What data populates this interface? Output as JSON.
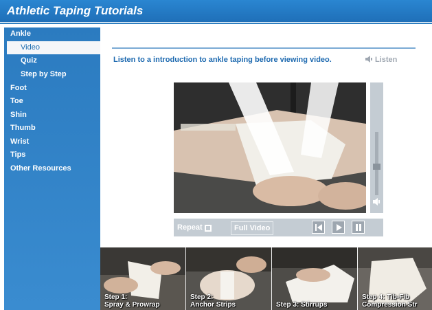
{
  "app": {
    "title": "Athletic Taping Tutorials"
  },
  "sidebar": {
    "items": [
      {
        "label": "Ankle",
        "level": "top"
      },
      {
        "label": "Video",
        "level": "sub",
        "active": true
      },
      {
        "label": "Quiz",
        "level": "sub"
      },
      {
        "label": "Step by Step",
        "level": "sub"
      },
      {
        "label": "Foot",
        "level": "top"
      },
      {
        "label": "Toe",
        "level": "top"
      },
      {
        "label": "Shin",
        "level": "top"
      },
      {
        "label": "Thumb",
        "level": "top"
      },
      {
        "label": "Wrist",
        "level": "top"
      },
      {
        "label": "Tips",
        "level": "top"
      },
      {
        "label": "Other Resources",
        "level": "top"
      }
    ]
  },
  "main": {
    "intro_text": "Listen to a introduction to ankle taping before viewing video.",
    "listen_label": "Listen"
  },
  "player": {
    "repeat_label": "Repeat",
    "full_video_label": "Full Video",
    "volume_level": 0.45
  },
  "steps": [
    {
      "line1": "Step 1:",
      "line2": "Spray & Prowrap"
    },
    {
      "line1": "Step 2:",
      "line2": "Anchor Strips"
    },
    {
      "line1": "",
      "line2": "Step 3: Stirrups"
    },
    {
      "line1": "Step 4: Tib-Fib",
      "line2": "Compression Str"
    }
  ],
  "colors": {
    "title_bar": "#2a86d1",
    "sidebar": "#2b7bc0",
    "accent_text": "#1e6ab0",
    "controls": "#c4ccd3"
  }
}
